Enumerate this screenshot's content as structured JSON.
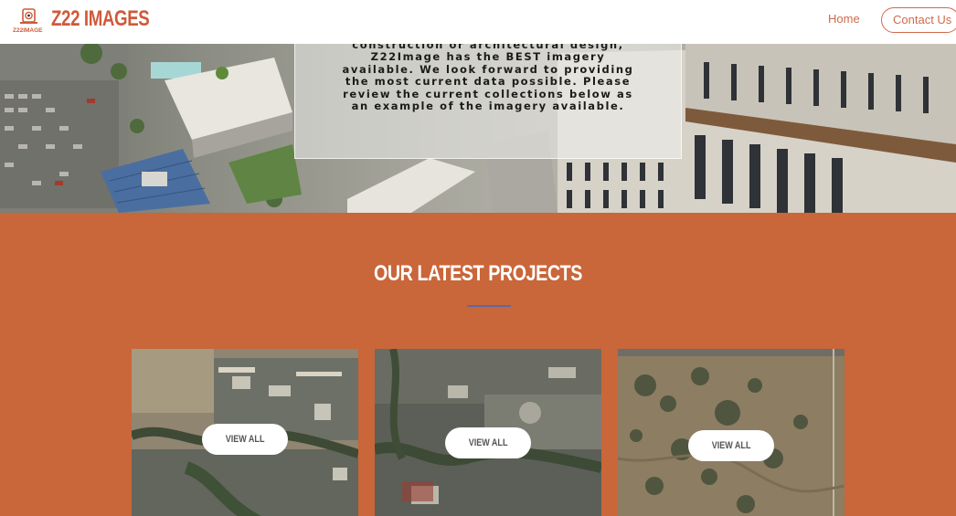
{
  "header": {
    "logo_caption": "Z22IMAGE",
    "brand": "Z22 IMAGES",
    "nav": {
      "home": "Home",
      "contact": "Contact Us"
    }
  },
  "hero": {
    "lines": [
      "construction or architectural design,",
      "Z22Image has the BEST imagery",
      "available. We look forward to providing",
      "the most current data possible. Please",
      "review the current collections below as",
      "an example of the imagery available."
    ]
  },
  "projects": {
    "title": "OUR LATEST PROJECTS",
    "cards": [
      {
        "button": "VIEW ALL"
      },
      {
        "button": "VIEW ALL"
      },
      {
        "button": "VIEW ALL"
      }
    ]
  },
  "colors": {
    "brand": "#cf5a3a",
    "section_bg": "#c9663a",
    "divider": "#5a6aa8"
  }
}
